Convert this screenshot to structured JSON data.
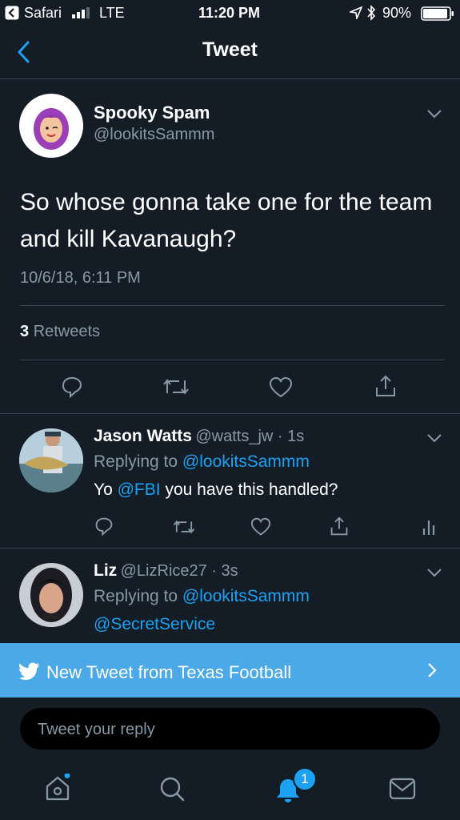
{
  "status_bar": {
    "back_app": "Safari",
    "carrier": "LTE",
    "time": "11:20 PM",
    "battery": "90%"
  },
  "nav": {
    "title": "Tweet"
  },
  "main_tweet": {
    "name": "Spooky Spam",
    "handle": "@lookitsSammm",
    "text": "So whose gonna take one for the team and kill Kavanaugh?",
    "timestamp": "10/6/18, 6:11 PM",
    "retweet_count": "3",
    "retweet_label": "Retweets"
  },
  "replies": [
    {
      "name": "Jason Watts",
      "meta": "@watts_jw · 1s",
      "replying_label": "Replying to",
      "replying_to": "@lookitsSammm",
      "text_prefix": "Yo",
      "mention": "@FBI",
      "text_suffix": "you have this handled?"
    },
    {
      "name": "Liz",
      "meta": "@LizRice27 · 3s",
      "replying_label": "Replying to",
      "replying_to": "@lookitsSammm",
      "mention": "@SecretService"
    }
  ],
  "banner": {
    "text": "New Tweet from Texas Football"
  },
  "reply_box": {
    "placeholder": "Tweet your reply"
  },
  "tab_bar": {
    "notification_badge": "1"
  },
  "colors": {
    "background": "#141d26",
    "accent": "#1da1f2",
    "banner": "#4ca9e8",
    "muted": "#8899a6"
  },
  "icons": [
    "back-chevron-icon",
    "signal-icon",
    "location-icon",
    "bluetooth-icon",
    "battery-icon",
    "reply-icon",
    "retweet-icon",
    "like-icon",
    "share-icon",
    "analytics-icon",
    "twitter-bird-icon",
    "home-icon",
    "search-icon",
    "notifications-icon",
    "messages-icon"
  ]
}
